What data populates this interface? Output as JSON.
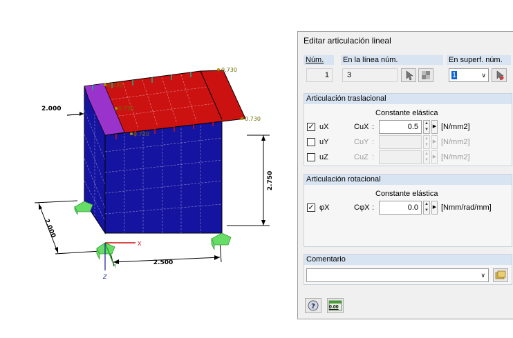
{
  "viewport": {
    "dims": {
      "left_height": "2.000",
      "depth": "2.000",
      "width": "2.500",
      "height": "2.750"
    },
    "labels": [
      "0.730",
      "0.730",
      "0.730",
      "0.730",
      "0.730"
    ],
    "axes": {
      "x": "X",
      "y": "Y",
      "z": "Z"
    },
    "colors": {
      "wall": "#1414a0",
      "roof": "#cc1111",
      "hinge": "#9933cc",
      "support": "#66dd66"
    }
  },
  "dialog": {
    "title": "Editar articulación lineal",
    "num_label": "Núm.",
    "num_value": "1",
    "line_label": "En la línea núm.",
    "line_value": "3",
    "surface_label": "En superf. núm.",
    "surface_value": "1",
    "trans_header": "Articulación traslacional",
    "trans_const": "Constante elástica",
    "rows": [
      {
        "check": true,
        "dof": "uX",
        "const": "CuX",
        "value": "0.5",
        "unit": "[N/mm2]"
      },
      {
        "check": false,
        "dof": "uY",
        "const": "CuY",
        "value": "",
        "unit": "[N/mm2]"
      },
      {
        "check": false,
        "dof": "uZ",
        "const": "CuZ",
        "value": "",
        "unit": "[N/mm2]"
      }
    ],
    "rot_header": "Articulación rotacional",
    "rot_const": "Constante elástica",
    "rot_row": {
      "check": true,
      "dof": "φX",
      "const": "CφX",
      "value": "0.0",
      "unit": "[Nmm/rad/mm]"
    },
    "comment_label": "Comentario",
    "comment_value": "",
    "footer_value": "0.00"
  }
}
